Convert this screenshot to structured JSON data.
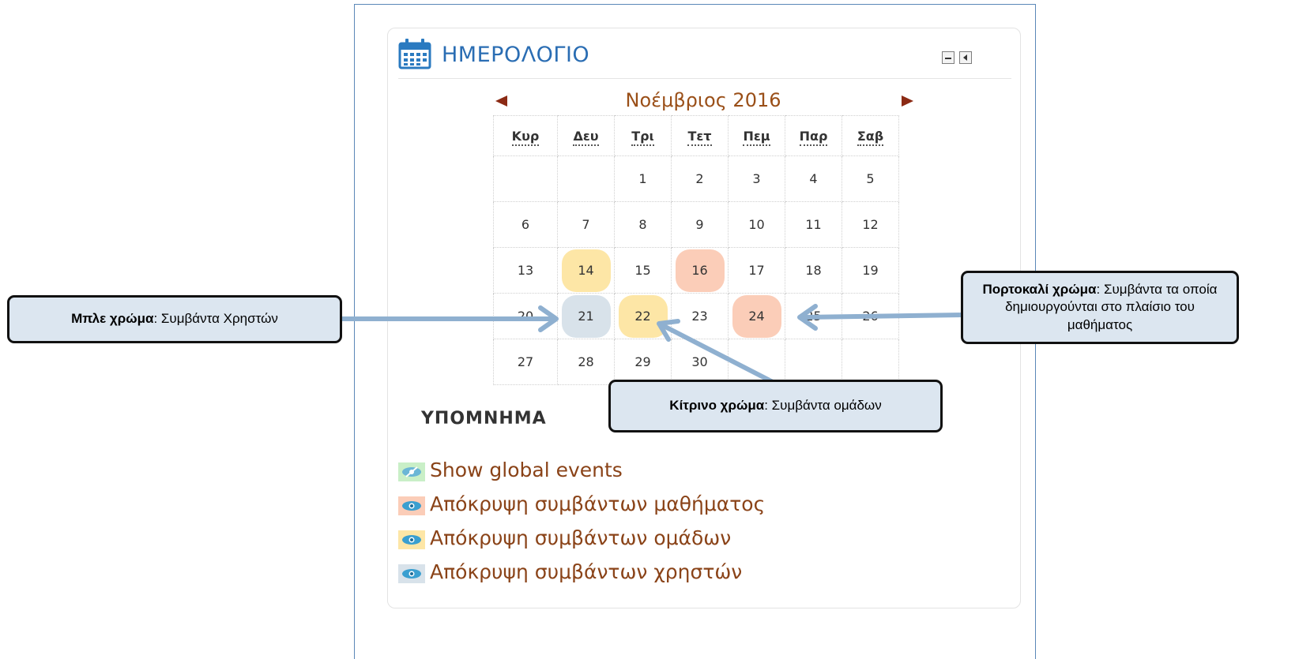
{
  "block": {
    "title": "ΗΜΕΡΟΛΟΓΙΟ",
    "icons": {
      "title_icon": "calendar-icon",
      "hide": "minimize-icon",
      "dock": "dock-icon"
    }
  },
  "calendar": {
    "month": "Νοέμβριος 2016",
    "nav": {
      "prev": "prev-month-arrow",
      "next": "next-month-arrow"
    },
    "weekdays": [
      "Κυρ",
      "Δευ",
      "Τρι",
      "Τετ",
      "Πεμ",
      "Παρ",
      "Σαβ"
    ],
    "weeks": [
      [
        "",
        "",
        "1",
        "2",
        "3",
        "4",
        "5"
      ],
      [
        "6",
        "7",
        "8",
        "9",
        "10",
        "11",
        "12"
      ],
      [
        "13",
        "14",
        "15",
        "16",
        "17",
        "18",
        "19"
      ],
      [
        "20",
        "21",
        "22",
        "23",
        "24",
        "25",
        "26"
      ],
      [
        "27",
        "28",
        "29",
        "30",
        "",
        "",
        ""
      ]
    ],
    "highlights": {
      "14": "group",
      "16": "course",
      "21": "user",
      "22": "group",
      "24": "course"
    }
  },
  "legend": {
    "title": "ΥΠΟΜΝΗΜΑ",
    "items": [
      {
        "label": "Show global events",
        "type": "global",
        "color": "#c9efc7",
        "icon": "eye-hidden-icon"
      },
      {
        "label": "Απόκρυψη συμβάντων μαθήματος",
        "type": "course",
        "color": "#fbcdb8",
        "icon": "eye-icon"
      },
      {
        "label": "Απόκρυψη συμβάντων ομάδων",
        "type": "group",
        "color": "#fde6a6",
        "icon": "eye-icon"
      },
      {
        "label": "Απόκρυψη συμβάντων χρηστών",
        "type": "user",
        "color": "#d8e2ea",
        "icon": "eye-icon"
      }
    ]
  },
  "callouts": {
    "blue": {
      "bold": "Μπλε χρώμα",
      "text": ": Συμβάντα Χρηστών"
    },
    "orange": {
      "bold": "Πορτοκαλί χρώμα",
      "text": ": Συμβάντα τα οποία δημιουργούνται στο πλαίσιο του μαθήματος"
    },
    "yellow": {
      "bold": "Κίτρινο χρώμα",
      "text": ": Συμβάντα ομάδων"
    }
  },
  "colors": {
    "course": "#fbcdb8",
    "group": "#fde6a6",
    "user": "#d8e2ea",
    "callout_bg": "#dce6f0",
    "arrow": "#8fb0d0",
    "title": "#2a6db3"
  }
}
